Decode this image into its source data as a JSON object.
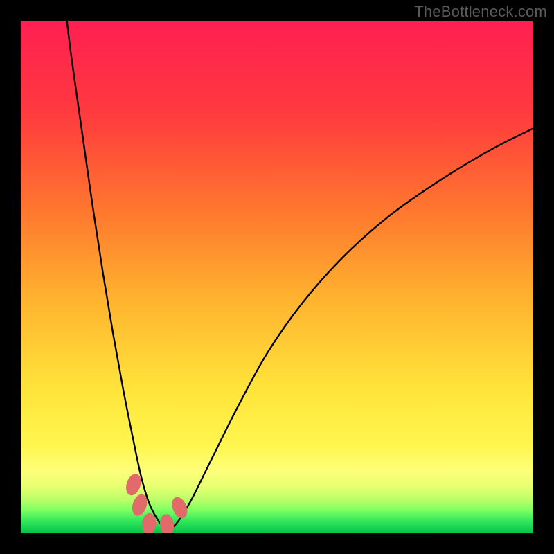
{
  "watermark": "TheBottleneck.com",
  "chart_data": {
    "type": "line",
    "title": "",
    "xlabel": "",
    "ylabel": "",
    "xlim": [
      0,
      100
    ],
    "ylim": [
      0,
      100
    ],
    "note": "No axes, ticks, or numeric labels are rendered in the image. x/y values below are read in percent-of-plot coordinates (0–100).",
    "series": [
      {
        "name": "curve",
        "color": "#000000",
        "x": [
          9,
          10,
          12,
          14,
          16,
          18,
          20,
          22,
          23.5,
          25,
          26.5,
          28,
          30,
          33,
          37,
          42,
          48,
          55,
          63,
          72,
          82,
          92,
          100
        ],
        "y": [
          100,
          92,
          78,
          64,
          51,
          39,
          28,
          18,
          11,
          6,
          3,
          1.2,
          1.5,
          6,
          14,
          24,
          35,
          45,
          54,
          62,
          69,
          75,
          79
        ]
      }
    ],
    "markers": [
      {
        "name": "marker-left-upper",
        "x": 22.0,
        "y": 9.5
      },
      {
        "name": "marker-left-lower",
        "x": 23.2,
        "y": 5.5
      },
      {
        "name": "marker-bottom-left",
        "x": 25.0,
        "y": 1.8
      },
      {
        "name": "marker-bottom-right",
        "x": 28.5,
        "y": 1.6
      },
      {
        "name": "marker-right",
        "x": 31.0,
        "y": 5.0
      }
    ],
    "marker_style": {
      "color": "#e36a6a",
      "rx": 10,
      "ry": 16,
      "stroke": "none"
    },
    "gradient_stops": [
      {
        "offset": 0.0,
        "color": "#ff1f52"
      },
      {
        "offset": 0.18,
        "color": "#ff3a3e"
      },
      {
        "offset": 0.38,
        "color": "#ff7a2e"
      },
      {
        "offset": 0.55,
        "color": "#ffb52f"
      },
      {
        "offset": 0.72,
        "color": "#ffe43a"
      },
      {
        "offset": 0.83,
        "color": "#fff64f"
      },
      {
        "offset": 0.88,
        "color": "#fdff7a"
      },
      {
        "offset": 0.91,
        "color": "#e6ff70"
      },
      {
        "offset": 0.935,
        "color": "#b8ff68"
      },
      {
        "offset": 0.955,
        "color": "#7dff62"
      },
      {
        "offset": 0.975,
        "color": "#35e85c"
      },
      {
        "offset": 1.0,
        "color": "#04c44a"
      }
    ]
  }
}
